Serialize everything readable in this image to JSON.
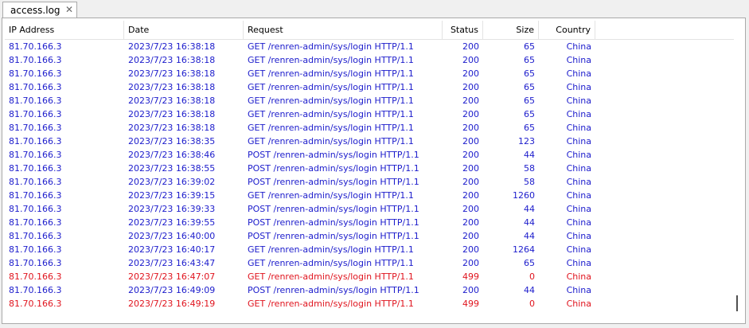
{
  "tab": {
    "label": "access.log",
    "close_icon": "✕"
  },
  "columns": {
    "ip": "IP Address",
    "date": "Date",
    "request": "Request",
    "status": "Status",
    "size": "Size",
    "country": "Country"
  },
  "colors": {
    "normal": "#1c1ccc",
    "error": "#e0141e"
  },
  "rows": [
    {
      "ip": "81.70.166.3",
      "date": "2023/7/23 16:38:18",
      "request": "GET /renren-admin/sys/login HTTP/1.1",
      "status": "200",
      "size": "65",
      "country": "China",
      "style": "blue"
    },
    {
      "ip": "81.70.166.3",
      "date": "2023/7/23 16:38:18",
      "request": "GET /renren-admin/sys/login HTTP/1.1",
      "status": "200",
      "size": "65",
      "country": "China",
      "style": "blue"
    },
    {
      "ip": "81.70.166.3",
      "date": "2023/7/23 16:38:18",
      "request": "GET /renren-admin/sys/login HTTP/1.1",
      "status": "200",
      "size": "65",
      "country": "China",
      "style": "blue"
    },
    {
      "ip": "81.70.166.3",
      "date": "2023/7/23 16:38:18",
      "request": "GET /renren-admin/sys/login HTTP/1.1",
      "status": "200",
      "size": "65",
      "country": "China",
      "style": "blue"
    },
    {
      "ip": "81.70.166.3",
      "date": "2023/7/23 16:38:18",
      "request": "GET /renren-admin/sys/login HTTP/1.1",
      "status": "200",
      "size": "65",
      "country": "China",
      "style": "blue"
    },
    {
      "ip": "81.70.166.3",
      "date": "2023/7/23 16:38:18",
      "request": "GET /renren-admin/sys/login HTTP/1.1",
      "status": "200",
      "size": "65",
      "country": "China",
      "style": "blue"
    },
    {
      "ip": "81.70.166.3",
      "date": "2023/7/23 16:38:18",
      "request": "GET /renren-admin/sys/login HTTP/1.1",
      "status": "200",
      "size": "65",
      "country": "China",
      "style": "blue"
    },
    {
      "ip": "81.70.166.3",
      "date": "2023/7/23 16:38:35",
      "request": "GET /renren-admin/sys/login HTTP/1.1",
      "status": "200",
      "size": "123",
      "country": "China",
      "style": "blue"
    },
    {
      "ip": "81.70.166.3",
      "date": "2023/7/23 16:38:46",
      "request": "POST /renren-admin/sys/login HTTP/1.1",
      "status": "200",
      "size": "44",
      "country": "China",
      "style": "blue"
    },
    {
      "ip": "81.70.166.3",
      "date": "2023/7/23 16:38:55",
      "request": "POST /renren-admin/sys/login HTTP/1.1",
      "status": "200",
      "size": "58",
      "country": "China",
      "style": "blue"
    },
    {
      "ip": "81.70.166.3",
      "date": "2023/7/23 16:39:02",
      "request": "POST /renren-admin/sys/login HTTP/1.1",
      "status": "200",
      "size": "58",
      "country": "China",
      "style": "blue"
    },
    {
      "ip": "81.70.166.3",
      "date": "2023/7/23 16:39:15",
      "request": "GET /renren-admin/sys/login HTTP/1.1",
      "status": "200",
      "size": "1260",
      "country": "China",
      "style": "blue"
    },
    {
      "ip": "81.70.166.3",
      "date": "2023/7/23 16:39:33",
      "request": "POST /renren-admin/sys/login HTTP/1.1",
      "status": "200",
      "size": "44",
      "country": "China",
      "style": "blue"
    },
    {
      "ip": "81.70.166.3",
      "date": "2023/7/23 16:39:55",
      "request": "POST /renren-admin/sys/login HTTP/1.1",
      "status": "200",
      "size": "44",
      "country": "China",
      "style": "blue"
    },
    {
      "ip": "81.70.166.3",
      "date": "2023/7/23 16:40:00",
      "request": "POST /renren-admin/sys/login HTTP/1.1",
      "status": "200",
      "size": "44",
      "country": "China",
      "style": "blue"
    },
    {
      "ip": "81.70.166.3",
      "date": "2023/7/23 16:40:17",
      "request": "GET /renren-admin/sys/login HTTP/1.1",
      "status": "200",
      "size": "1264",
      "country": "China",
      "style": "blue"
    },
    {
      "ip": "81.70.166.3",
      "date": "2023/7/23 16:43:47",
      "request": "GET /renren-admin/sys/login HTTP/1.1",
      "status": "200",
      "size": "65",
      "country": "China",
      "style": "blue"
    },
    {
      "ip": "81.70.166.3",
      "date": "2023/7/23 16:47:07",
      "request": "GET /renren-admin/sys/login HTTP/1.1",
      "status": "499",
      "size": "0",
      "country": "China",
      "style": "red"
    },
    {
      "ip": "81.70.166.3",
      "date": "2023/7/23 16:49:09",
      "request": "POST /renren-admin/sys/login HTTP/1.1",
      "status": "200",
      "size": "44",
      "country": "China",
      "style": "blue"
    },
    {
      "ip": "81.70.166.3",
      "date": "2023/7/23 16:49:19",
      "request": "GET /renren-admin/sys/login HTTP/1.1",
      "status": "499",
      "size": "0",
      "country": "China",
      "style": "red"
    }
  ]
}
